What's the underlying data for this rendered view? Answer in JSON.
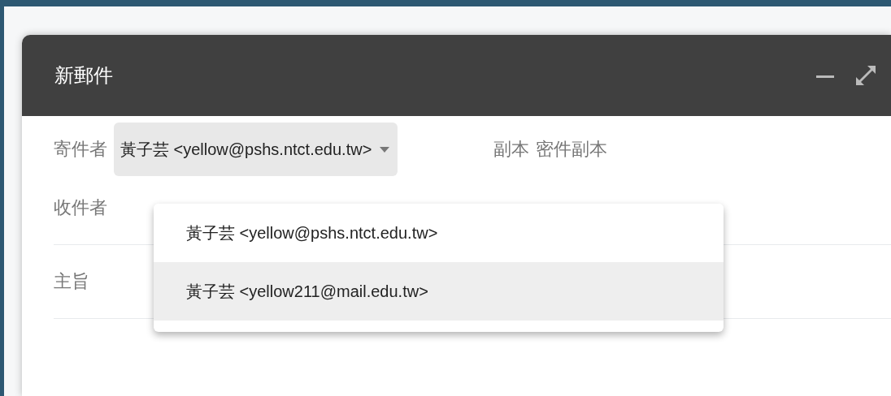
{
  "window": {
    "title": "新郵件"
  },
  "from": {
    "label": "寄件者",
    "value": "黃子芸 <yellow@pshs.ntct.edu.tw>"
  },
  "cc_links": [
    "副本",
    "密件副本"
  ],
  "to": {
    "label": "收件者"
  },
  "subject": {
    "label": "主旨"
  },
  "sender_menu": [
    {
      "label": "黃子芸 <yellow@pshs.ntct.edu.tw>",
      "highlighted": false
    },
    {
      "label": "黃子芸 <yellow211@mail.edu.tw>",
      "highlighted": true
    }
  ]
}
